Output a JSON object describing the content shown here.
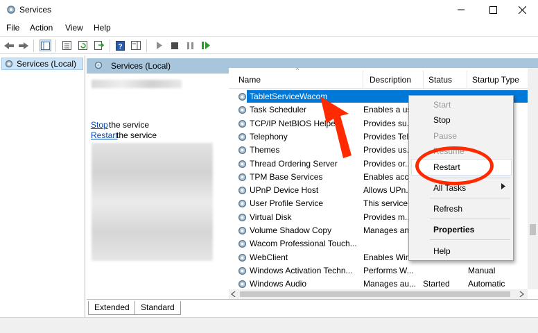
{
  "window": {
    "title": "Services",
    "controls": {
      "minimize": "—",
      "maximize": "☐",
      "close": "✕"
    }
  },
  "menu": [
    "File",
    "Action",
    "View",
    "Help"
  ],
  "toolbar": {
    "icons": [
      "back-icon",
      "forward-icon",
      "show-hide-tree-icon",
      "properties-icon",
      "refresh-icon",
      "export-list-icon",
      "help-icon",
      "show-action-pane-icon",
      "start-service-icon",
      "stop-service-icon",
      "pause-service-icon",
      "resume-service-icon"
    ]
  },
  "tree": {
    "label": "Services (Local)"
  },
  "panel": {
    "header": "Services (Local)",
    "stop_link": "Stop",
    "stop_rest": "the service",
    "restart_link": "Restart",
    "restart_rest": "the service"
  },
  "columns": {
    "name": "Name",
    "description": "Description",
    "status": "Status",
    "startup": "Startup Type"
  },
  "services": [
    {
      "name": "TabletServiceWacom",
      "description": "",
      "status": "",
      "startup": "",
      "selected": true
    },
    {
      "name": "Task Scheduler",
      "description": "Enables a us",
      "status": "",
      "startup": ""
    },
    {
      "name": "TCP/IP NetBIOS Helper",
      "description": "Provides su.",
      "status": "",
      "startup": ""
    },
    {
      "name": "Telephony",
      "description": "Provides Tel",
      "status": "",
      "startup": ""
    },
    {
      "name": "Themes",
      "description": "Provides us.",
      "status": "",
      "startup": ""
    },
    {
      "name": "Thread Ordering Server",
      "description": "Provides or..",
      "status": "",
      "startup": ""
    },
    {
      "name": "TPM Base Services",
      "description": "Enables acc",
      "status": "",
      "startup": ""
    },
    {
      "name": "UPnP Device Host",
      "description": "Allows UPn..",
      "status": "",
      "startup": ""
    },
    {
      "name": "User Profile Service",
      "description": "This service",
      "status": "",
      "startup": ""
    },
    {
      "name": "Virtual Disk",
      "description": "Provides m..",
      "status": "",
      "startup": ""
    },
    {
      "name": "Volume Shadow Copy",
      "description": "Manages an",
      "status": "",
      "startup": ""
    },
    {
      "name": "Wacom Professional Touch...",
      "description": "",
      "status": "",
      "startup": ""
    },
    {
      "name": "WebClient",
      "description": "Enables Win",
      "status": "",
      "startup": ""
    },
    {
      "name": "Windows Activation Techn...",
      "description": "Performs W...",
      "status": "",
      "startup": "Manual"
    },
    {
      "name": "Windows Audio",
      "description": "Manages au...",
      "status": "Started",
      "startup": "Automatic"
    }
  ],
  "context_menu": {
    "start": "Start",
    "stop": "Stop",
    "pause": "Pause",
    "resume": "Resume",
    "restart": "Restart",
    "all_tasks": "All Tasks",
    "refresh": "Refresh",
    "properties": "Properties",
    "help": "Help"
  },
  "tabs": {
    "extended": "Extended",
    "standard": "Standard"
  },
  "colors": {
    "selection": "#0078d7",
    "header_band": "#a7c5db",
    "annotation": "#ff2a00",
    "link": "#0645ad"
  }
}
